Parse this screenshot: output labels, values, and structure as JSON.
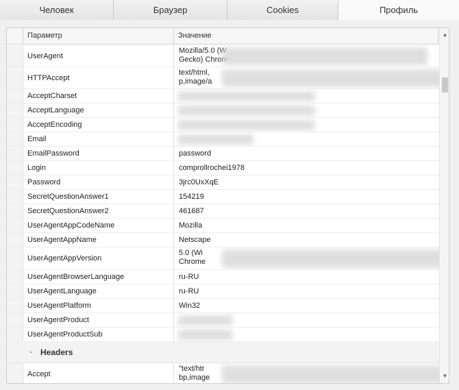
{
  "tabs": [
    {
      "label": "Человек",
      "active": false
    },
    {
      "label": "Браузер",
      "active": false
    },
    {
      "label": "Cookies",
      "active": false
    },
    {
      "label": "Профиль",
      "active": true
    }
  ],
  "grid": {
    "col_param": "Параметр",
    "col_value": "Значение",
    "rows": [
      {
        "param": "UserAgent",
        "value": "Mozilla/5.0 (W",
        "value2": "Gecko) Chrom",
        "blurred": true
      },
      {
        "param": "HTTPAccept",
        "value": "text/html,",
        "value2": "p,image/a",
        "blurred": true
      },
      {
        "param": "AcceptCharset",
        "value": "",
        "blurred": true
      },
      {
        "param": "AcceptLanguage",
        "value": "",
        "blurred": true
      },
      {
        "param": "AcceptEncoding",
        "value": "",
        "blurred": true
      },
      {
        "param": "Email",
        "value": "",
        "blurred": true
      },
      {
        "param": "EmailPassword",
        "value": "password"
      },
      {
        "param": "Login",
        "value": "comprollrochei1978"
      },
      {
        "param": "Password",
        "value": "3jrc0UxXqE"
      },
      {
        "param": "SecretQuestionAnswer1",
        "value": "154219"
      },
      {
        "param": "SecretQuestionAnswer2",
        "value": "461687"
      },
      {
        "param": "UserAgentAppCodeName",
        "value": "Mozilla"
      },
      {
        "param": "UserAgentAppName",
        "value": "Netscape"
      },
      {
        "param": "UserAgentAppVersion",
        "value": "5.0 (Wi",
        "value2": "Chrome",
        "blurred": true
      },
      {
        "param": "UserAgentBrowserLanguage",
        "value": "ru-RU"
      },
      {
        "param": "UserAgentLanguage",
        "value": "ru-RU"
      },
      {
        "param": "UserAgentPlatform",
        "value": "Win32"
      },
      {
        "param": "UserAgentProduct",
        "value": "",
        "blurred": true
      },
      {
        "param": "UserAgentProductSub",
        "value": "",
        "blurred": true
      }
    ],
    "section": {
      "title": "Headers"
    },
    "rows_after": [
      {
        "param": "Accept",
        "value": "\"text/htr",
        "value2": "bp,image",
        "blurred": true
      }
    ]
  },
  "icons": {
    "section_toggle": "chevron-down-icon",
    "scroll_up": "arrow-up-icon",
    "scroll_down": "arrow-down-icon"
  }
}
